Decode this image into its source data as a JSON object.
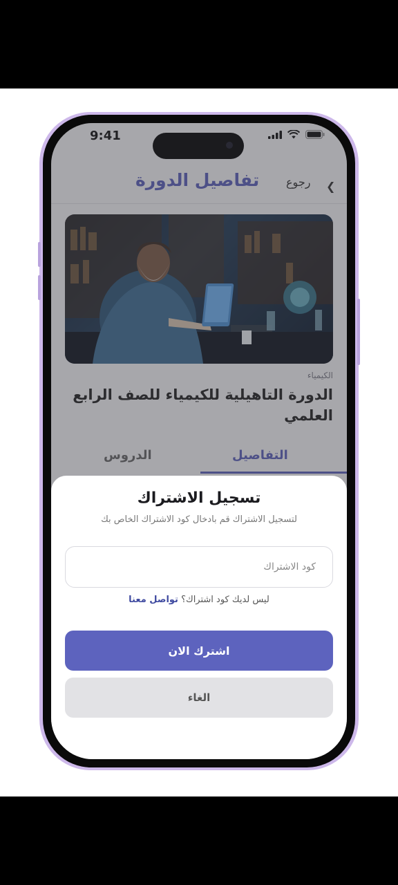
{
  "status_bar": {
    "time": "9:41"
  },
  "header": {
    "title": "تفاصيل الدورة",
    "back_label": "رجوع"
  },
  "course": {
    "category": "الكيمياء",
    "title": "الدورة التاهيلية للكيمياء للصف الرابع العلمي"
  },
  "tabs": [
    {
      "label": "التفاصيل",
      "active": true
    },
    {
      "label": "الدروس",
      "active": false
    }
  ],
  "modal": {
    "title": "تسجيل الاشتراك",
    "subtitle": "لتسجيل الاشتراك قم بادخال كود الاشتراك الخاص بك",
    "input_placeholder": "كود الاشتراك",
    "input_value": "",
    "help_text": "ليس لديك كود اشتراك؟",
    "help_link": "تواصل معنا",
    "subscribe_label": "اشترك الان",
    "cancel_label": "الغاء"
  },
  "colors": {
    "accent": "#5d63be",
    "frame": "#cdb8ea",
    "secondary_button": "#e2e2e5"
  }
}
